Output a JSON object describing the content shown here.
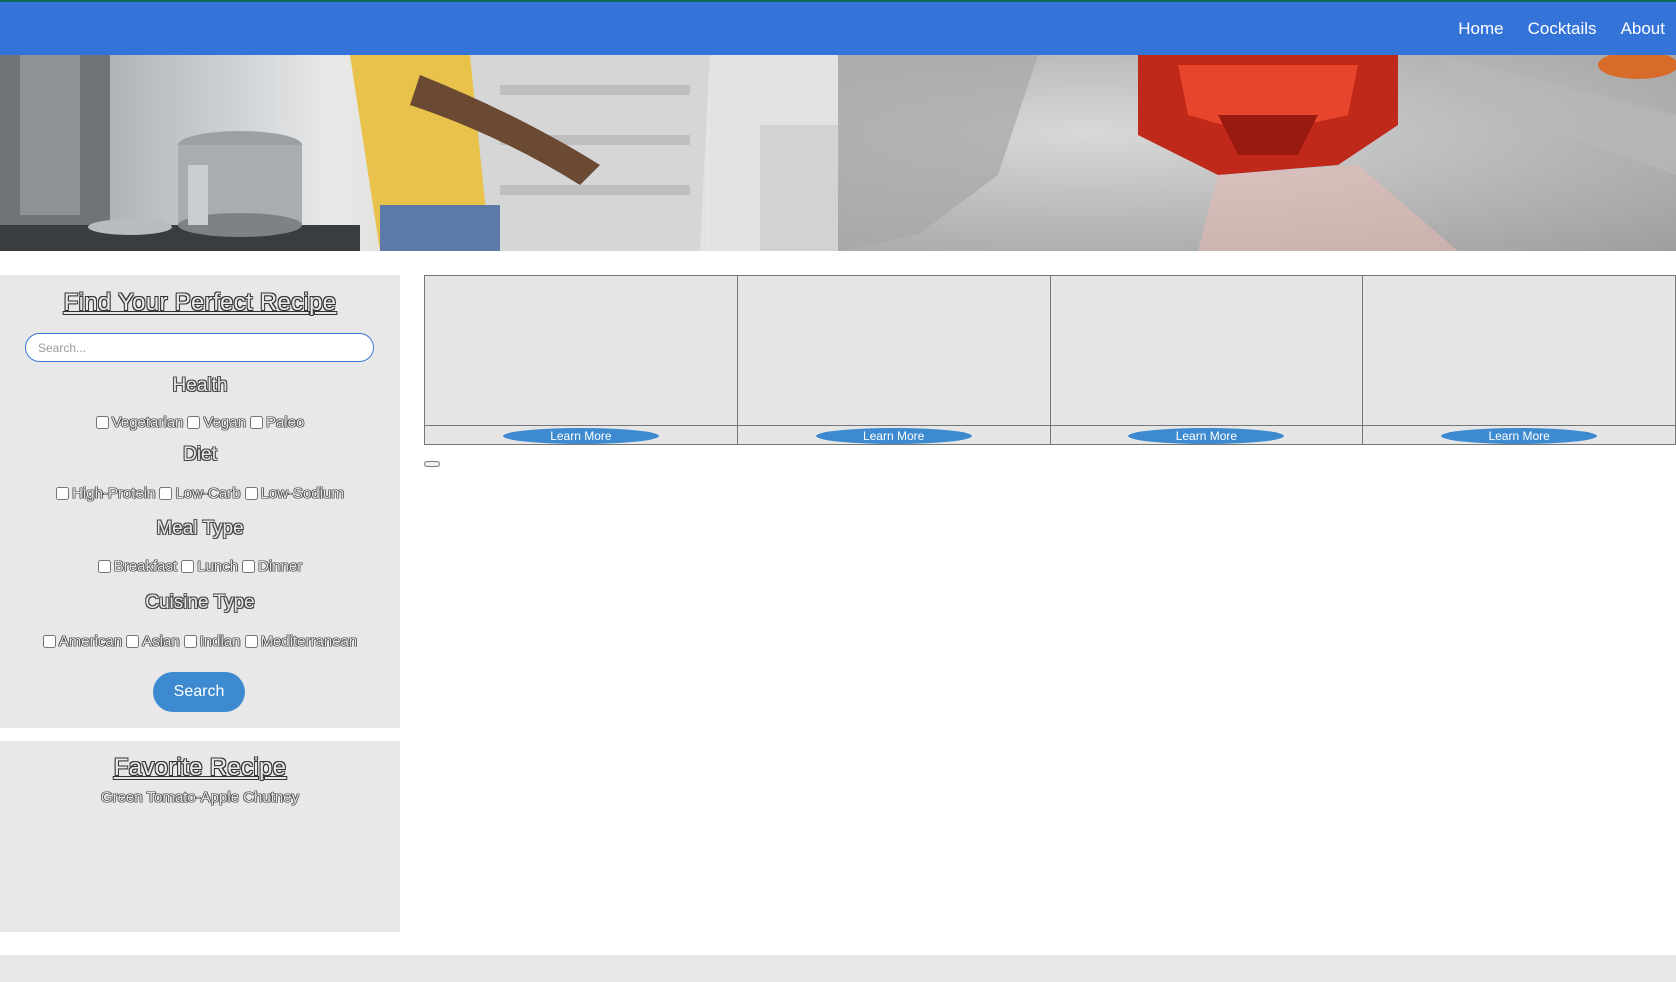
{
  "nav": {
    "links": [
      "Home",
      "Cocktails",
      "About"
    ]
  },
  "search_panel": {
    "title": "Find Your Perfect Recipe",
    "search_placeholder": "Search...",
    "sections": [
      {
        "title": "Health",
        "options": [
          "Vegetarian",
          "Vegan",
          "Paleo"
        ]
      },
      {
        "title": "Diet",
        "options": [
          "High-Protein",
          "Low-Carb",
          "Low-Sodium"
        ]
      },
      {
        "title": "Meal Type",
        "options": [
          "Breakfast",
          "Lunch",
          "Dinner"
        ]
      },
      {
        "title": "Cuisine Type",
        "options": [
          "American",
          "Asian",
          "Indian",
          "Mediterranean"
        ]
      }
    ],
    "search_button": "Search"
  },
  "favorites": {
    "title": "Favorite Recipe",
    "items": [
      "Green Tomato-Apple Chutney"
    ]
  },
  "cards": [
    {
      "button": "Learn More"
    },
    {
      "button": "Learn More"
    },
    {
      "button": "Learn More"
    },
    {
      "button": "Learn More"
    }
  ],
  "colors": {
    "navbar": "#3474d9",
    "accent_button": "#3d8ad0",
    "panel_bg": "#e8e8e8"
  }
}
